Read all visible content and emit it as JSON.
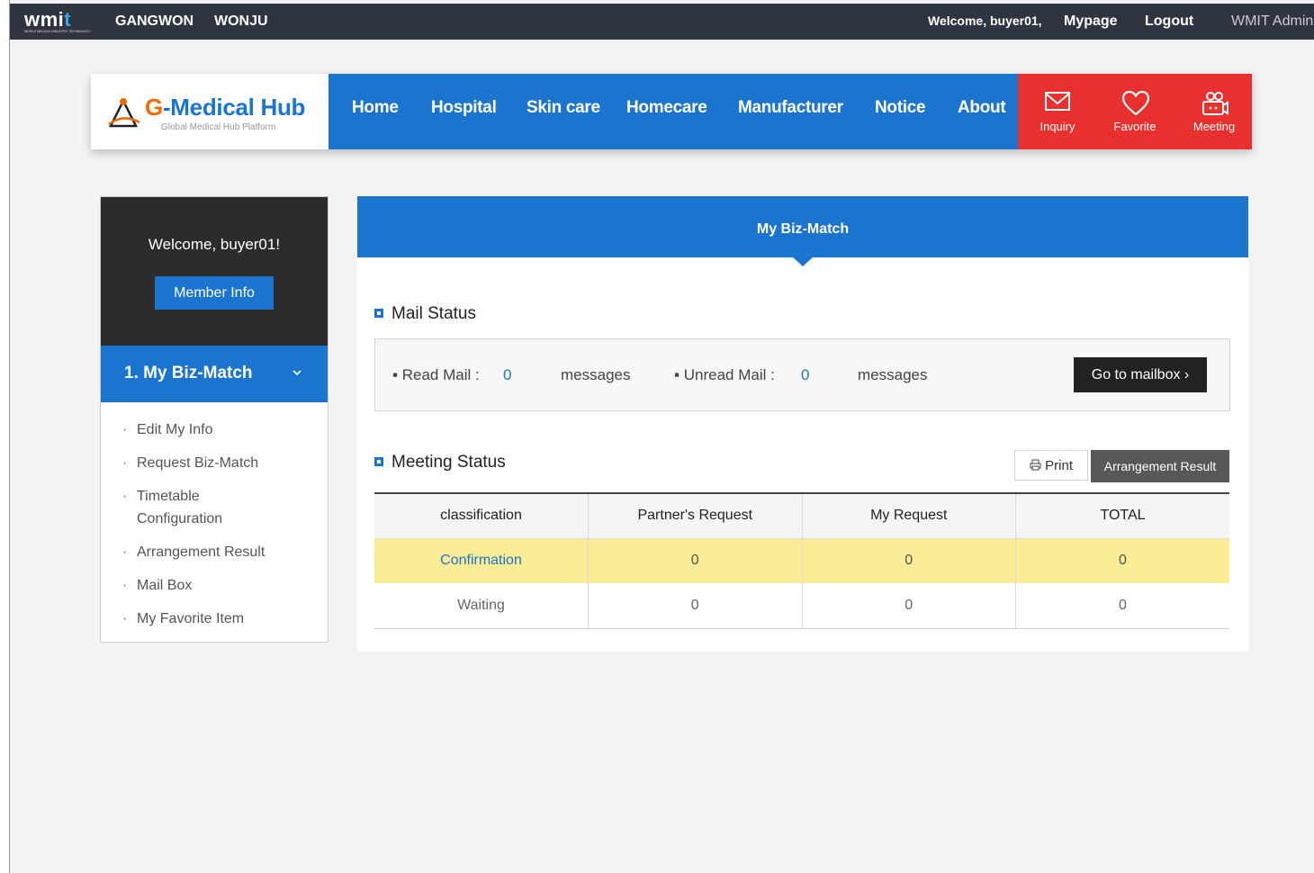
{
  "topbar": {
    "logo_text": "wmi",
    "logo_accent": "t",
    "logo_sub": "WORLD MEDICAL INDUSTRY TECHNOLOGY",
    "regions": [
      "GANGWON",
      "WONJU"
    ],
    "welcome": "Welcome, buyer01,",
    "mypage": "Mypage",
    "logout": "Logout",
    "admin": "WMIT Admin"
  },
  "header": {
    "brand_name_g": "G",
    "brand_name_rest": "-Medical Hub",
    "brand_tagline": "Global Medical Hub Platform",
    "nav": [
      "Home",
      "Hospital",
      "Skin care",
      "Homecare",
      "Manufacturer",
      "Notice",
      "About"
    ],
    "quick": [
      {
        "label": "Inquiry",
        "icon": "mail-icon"
      },
      {
        "label": "Favorite",
        "icon": "heart-icon"
      },
      {
        "label": "Meeting",
        "icon": "meeting-icon"
      }
    ]
  },
  "sidebar": {
    "welcome": "Welcome, buyer01!",
    "member_button": "Member Info",
    "menu_title": "1. My Biz-Match",
    "links": [
      "Edit My Info",
      "Request Biz-Match",
      "Timetable Configuration",
      "Arrangement Result",
      "Mail Box",
      "My Favorite Item"
    ]
  },
  "content": {
    "banner": "My Biz-Match",
    "mail_section": {
      "title": "Mail Status",
      "read_label": "▪ Read Mail :",
      "read_count": "0",
      "unread_label": "▪ Unread Mail :",
      "unread_count": "0",
      "unit": "messages",
      "button": "Go to mailbox ›"
    },
    "meeting_section": {
      "title": "Meeting Status",
      "print_button": "Print",
      "arrangement_button": "Arrangement Result",
      "columns": [
        "classification",
        "Partner's Request",
        "My Request",
        "TOTAL"
      ],
      "rows": [
        [
          "Confirmation",
          "0",
          "0",
          "0"
        ],
        [
          "Waiting",
          "0",
          "0",
          "0"
        ]
      ]
    }
  },
  "colors": {
    "primary_blue": "#1b75cf",
    "quick_red": "#e8302e",
    "topbar": "#2f3540",
    "highlight_row": "#fbed96"
  }
}
